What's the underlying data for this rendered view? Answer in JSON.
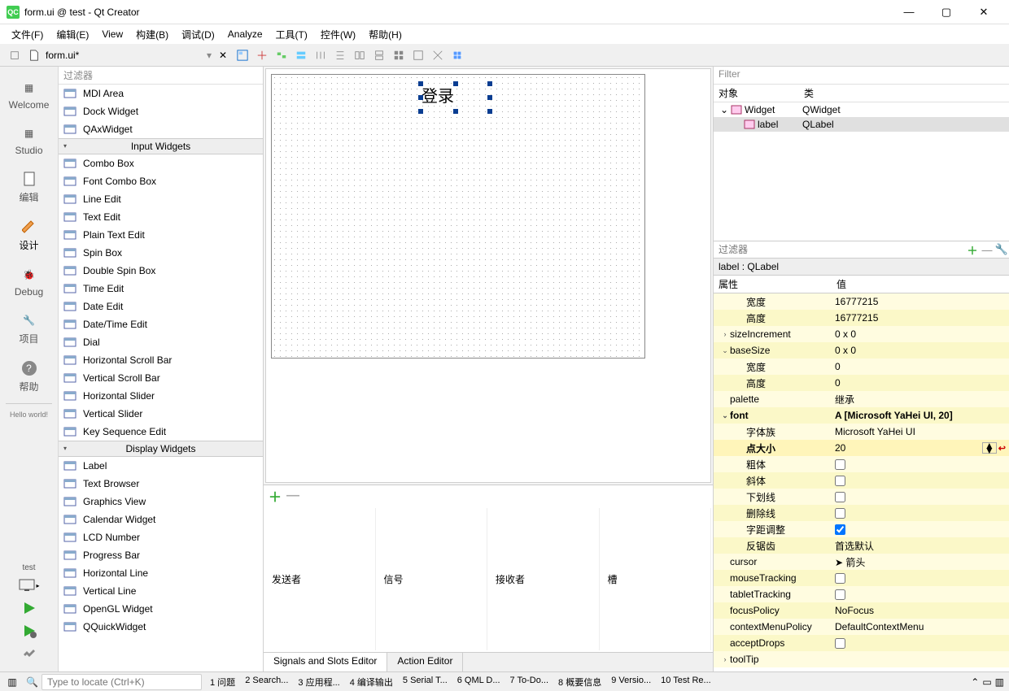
{
  "window": {
    "title": "form.ui @ test - Qt Creator"
  },
  "menu": [
    "文件(F)",
    "编辑(E)",
    "View",
    "构建(B)",
    "调试(D)",
    "Analyze",
    "工具(T)",
    "控件(W)",
    "帮助(H)"
  ],
  "toolbar": {
    "filename": "form.ui*"
  },
  "leftbar": {
    "items": [
      "Welcome",
      "Studio",
      "编辑",
      "设计",
      "Debug",
      "项目",
      "帮助"
    ],
    "hello": "Hello world!",
    "project": "test"
  },
  "widgetbox": {
    "filter_placeholder": "过滤器",
    "top_items": [
      "MDI Area",
      "Dock Widget",
      "QAxWidget"
    ],
    "group_input": "Input Widgets",
    "input_items": [
      "Combo Box",
      "Font Combo Box",
      "Line Edit",
      "Text Edit",
      "Plain Text Edit",
      "Spin Box",
      "Double Spin Box",
      "Time Edit",
      "Date Edit",
      "Date/Time Edit",
      "Dial",
      "Horizontal Scroll Bar",
      "Vertical Scroll Bar",
      "Horizontal Slider",
      "Vertical Slider",
      "Key Sequence Edit"
    ],
    "group_display": "Display Widgets",
    "display_items": [
      "Label",
      "Text Browser",
      "Graphics View",
      "Calendar Widget",
      "LCD Number",
      "Progress Bar",
      "Horizontal Line",
      "Vertical Line",
      "OpenGL Widget",
      "QQuickWidget"
    ]
  },
  "canvas": {
    "label_text": "登录"
  },
  "signals": {
    "headers": [
      "发送者",
      "信号",
      "接收者",
      "槽"
    ],
    "tabs": [
      "Signals and Slots Editor",
      "Action Editor"
    ]
  },
  "objects": {
    "filter_placeholder": "Filter",
    "col1": "对象",
    "col2": "类",
    "rows": [
      {
        "name": "Widget",
        "class": "QWidget",
        "indent": 0,
        "expander": "⌄"
      },
      {
        "name": "label",
        "class": "QLabel",
        "indent": 1,
        "expander": "",
        "selected": true
      }
    ]
  },
  "properties": {
    "filter_placeholder": "过滤器",
    "title": "label : QLabel",
    "col1": "属性",
    "col2": "值",
    "rows": [
      {
        "k": "宽度",
        "v": "16777215",
        "indent": 2,
        "sh": "y2"
      },
      {
        "k": "高度",
        "v": "16777215",
        "indent": 2,
        "sh": "y1"
      },
      {
        "k": "sizeIncrement",
        "v": "0 x 0",
        "indent": 0,
        "exp": "›",
        "sh": "y2"
      },
      {
        "k": "baseSize",
        "v": "0 x 0",
        "indent": 0,
        "exp": "⌄",
        "sh": "y1"
      },
      {
        "k": "宽度",
        "v": "0",
        "indent": 2,
        "sh": "y2"
      },
      {
        "k": "高度",
        "v": "0",
        "indent": 2,
        "sh": "y1"
      },
      {
        "k": "palette",
        "v": "继承",
        "indent": 0,
        "sh": "y2"
      },
      {
        "k": "font",
        "v": "A  [Microsoft YaHei UI, 20]",
        "indent": 0,
        "exp": "⌄",
        "sh": "y1",
        "bold": true
      },
      {
        "k": "字体族",
        "v": "Microsoft YaHei UI",
        "indent": 2,
        "sh": "y2"
      },
      {
        "k": "点大小",
        "v": "20",
        "indent": 2,
        "sh": "ysel",
        "spin": true,
        "bold": true
      },
      {
        "k": "粗体",
        "v": "",
        "indent": 2,
        "sh": "y2",
        "check": false
      },
      {
        "k": "斜体",
        "v": "",
        "indent": 2,
        "sh": "y1",
        "check": false
      },
      {
        "k": "下划线",
        "v": "",
        "indent": 2,
        "sh": "y2",
        "check": false
      },
      {
        "k": "删除线",
        "v": "",
        "indent": 2,
        "sh": "y1",
        "check": false
      },
      {
        "k": "字距调整",
        "v": "",
        "indent": 2,
        "sh": "y2",
        "check": true
      },
      {
        "k": "反锯齿",
        "v": "首选默认",
        "indent": 2,
        "sh": "y1"
      },
      {
        "k": "cursor",
        "v": "➤ 箭头",
        "indent": 0,
        "sh": "y2"
      },
      {
        "k": "mouseTracking",
        "v": "",
        "indent": 0,
        "sh": "y1",
        "check": false
      },
      {
        "k": "tabletTracking",
        "v": "",
        "indent": 0,
        "sh": "y2",
        "check": false
      },
      {
        "k": "focusPolicy",
        "v": "NoFocus",
        "indent": 0,
        "sh": "y1"
      },
      {
        "k": "contextMenuPolicy",
        "v": "DefaultContextMenu",
        "indent": 0,
        "sh": "y2"
      },
      {
        "k": "acceptDrops",
        "v": "",
        "indent": 0,
        "sh": "y1",
        "check": false
      },
      {
        "k": "toolTip",
        "v": "",
        "indent": 0,
        "exp": "›",
        "sh": "y2"
      }
    ]
  },
  "statusbar": {
    "locator_placeholder": "Type to locate (Ctrl+K)",
    "items": [
      "1  问题",
      "2  Search...",
      "3  应用程...",
      "4  编译输出",
      "5  Serial T...",
      "6  QML D...",
      "7  To-Do...",
      "8  概要信息",
      "9  Versio...",
      "10  Test Re..."
    ]
  }
}
